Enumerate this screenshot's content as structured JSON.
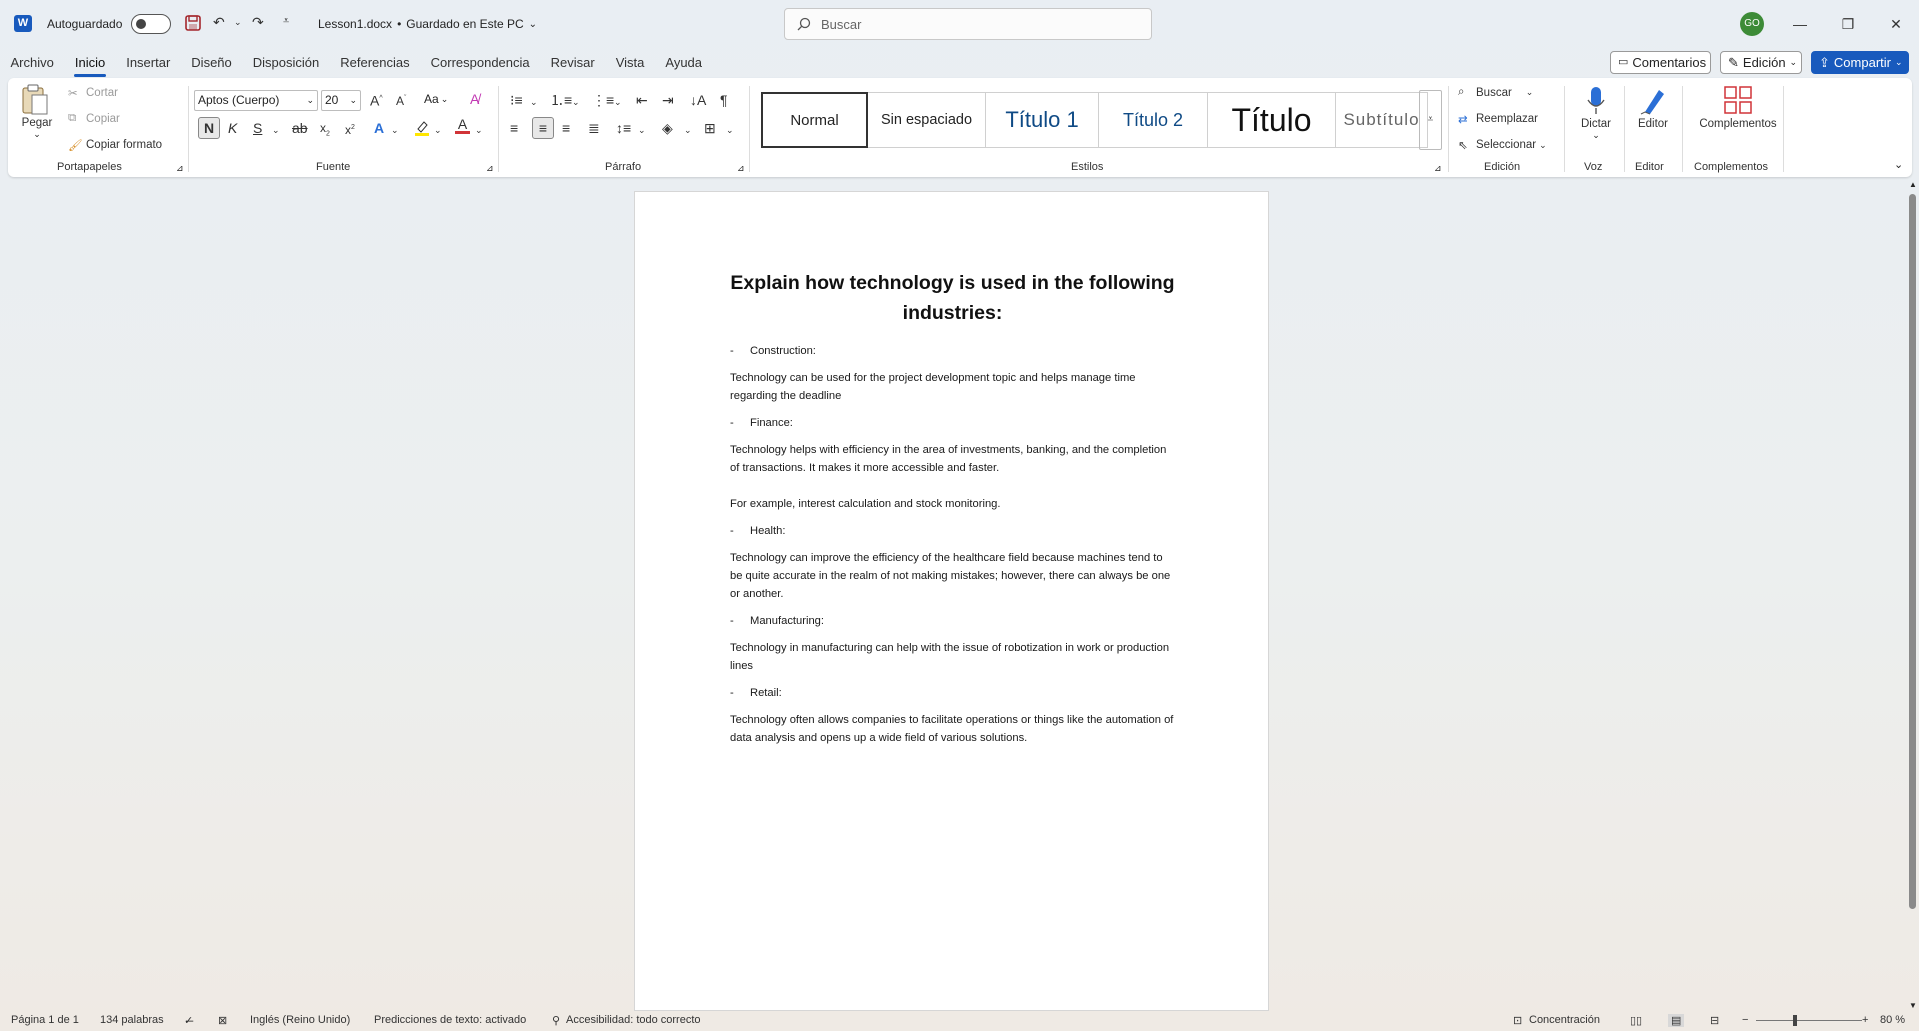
{
  "titlebar": {
    "autosave_label": "Autoguardado",
    "doc_title": "Lesson1.docx",
    "save_status": "Guardado en Este PC",
    "search_placeholder": "Buscar",
    "avatar_initials": "GO"
  },
  "menu": {
    "tabs": [
      "Archivo",
      "Inicio",
      "Insertar",
      "Diseño",
      "Disposición",
      "Referencias",
      "Correspondencia",
      "Revisar",
      "Vista",
      "Ayuda"
    ],
    "active_tab": "Inicio",
    "comments": "Comentarios",
    "editing": "Edición",
    "share": "Compartir"
  },
  "ribbon": {
    "clipboard": {
      "paste": "Pegar",
      "cut": "Cortar",
      "copy": "Copiar",
      "format_painter": "Copiar formato",
      "group": "Portapapeles"
    },
    "font": {
      "name": "Aptos (Cuerpo)",
      "size": "20",
      "change_case": "Aa",
      "group": "Fuente"
    },
    "paragraph": {
      "group": "Párrafo"
    },
    "styles": {
      "items": [
        "Normal",
        "Sin espaciado",
        "Título 1",
        "Título 2",
        "Título",
        "Subtítulo"
      ],
      "group": "Estilos"
    },
    "editing": {
      "find": "Buscar",
      "replace": "Reemplazar",
      "select": "Seleccionar",
      "group": "Edición"
    },
    "voice": {
      "dictate": "Dictar",
      "group": "Voz"
    },
    "editor": {
      "label": "Editor",
      "group": "Editor"
    },
    "addins": {
      "label": "Complementos",
      "group": "Complementos"
    }
  },
  "document": {
    "title": "Explain how technology is used in the following industries:",
    "sections": [
      {
        "heading": "Construction:",
        "paragraphs": [
          "Technology can be used for the project development topic and helps manage time regarding the deadline"
        ]
      },
      {
        "heading": "Finance:",
        "paragraphs": [
          "Technology helps with efficiency in the area of investments, banking, and the completion of transactions. It makes it more accessible and faster.",
          "",
          "For example, interest calculation and stock monitoring."
        ]
      },
      {
        "heading": "Health:",
        "paragraphs": [
          "Technology can improve the efficiency of the healthcare field because machines tend to be quite accurate in the realm of not making mistakes; however, there can always be one or another."
        ]
      },
      {
        "heading": "Manufacturing:",
        "paragraphs": [
          "Technology in manufacturing can help with the issue of robotization in work or production lines"
        ]
      },
      {
        "heading": "Retail:",
        "paragraphs": [
          "Technology often allows companies to facilitate operations or things like the automation of data analysis and opens up a wide field of various solutions."
        ]
      }
    ]
  },
  "statusbar": {
    "page": "Página 1 de 1",
    "words": "134 palabras",
    "language": "Inglés (Reino Unido)",
    "predictions": "Predicciones de texto: activado",
    "accessibility": "Accesibilidad: todo correcto",
    "focus": "Concentración",
    "zoom": "80 %"
  },
  "colors": {
    "accent": "#185abd",
    "avatar": "#3d8b37",
    "font_red": "#d13438",
    "highlight": "#ffe600"
  }
}
